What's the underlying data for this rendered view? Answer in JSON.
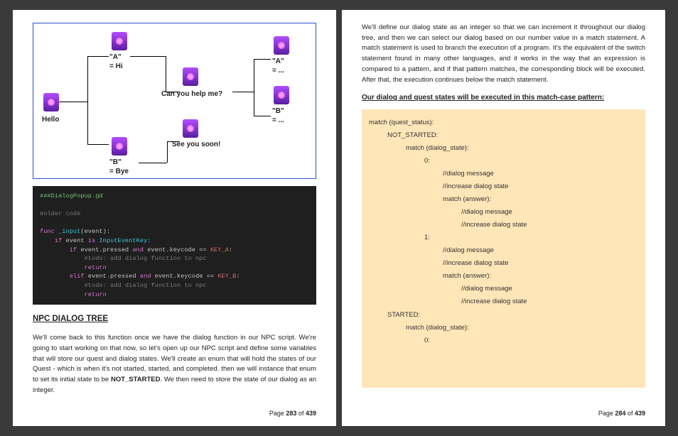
{
  "page_left": {
    "diagram": {
      "hello": "Hello",
      "a_hi_key": "\"A\"",
      "a_hi_val": "= Hi",
      "b_bye_key": "\"B\"",
      "b_bye_val": "= Bye",
      "can_help": "Can you help me?",
      "see_you": "See you soon!",
      "topA_key": "\"A\"",
      "topA_val": "= ...",
      "topB_key": "\"B\"",
      "topB_val": "= ..."
    },
    "code": {
      "l1": "###DialogPopup.gd",
      "l2": "#older code",
      "l3a": "func",
      "l3b": " _input",
      "l3c": "(event):",
      "l4a": "    if",
      "l4b": " event ",
      "l4c": "is",
      "l4d": " InputEventKey:",
      "l5a": "        if",
      "l5b": " event.pressed ",
      "l5c": "and",
      "l5d": " event.keycode == ",
      "l5e": "KEY_A",
      "l5f": ":",
      "l6": "            #todo: add dialog function to npc",
      "l7": "            return",
      "l8a": "        elif",
      "l8b": " event.pressed ",
      "l8c": "and",
      "l8d": " event.keycode == ",
      "l8e": "KEY_B",
      "l8f": ":",
      "l9": "            #todo: add dialog function to npc",
      "l10": "            return"
    },
    "heading": "NPC DIALOG TREE",
    "para_pre": "We'll come back to this function once we have the dialog function in our NPC script. We're going to start working on that now, so let's open up our NPC script and define some variables that will store our quest and dialog states. We'll create an enum that will hold the states of our Quest - which is when it's not started, started, and completed. then we will instance that enum to set its initial state to be ",
    "para_bold": "NOT_STARTED",
    "para_post": ". We then need to store the state of our dialog as an integer.",
    "pagelabel_pre": "Page ",
    "pagelabel_num": "283",
    "pagelabel_mid": " of ",
    "pagelabel_total": "439"
  },
  "page_right": {
    "para": "We'll define our dialog state as an integer so that we can increment it throughout our dialog tree, and then we can select our dialog based on our number value in a match statement. A match statement is used to branch the execution of a program. It's the equivalent of the switch statement found in many other languages, and it works in the way that an expression is compared to a pattern, and if that pattern matches, the corresponding block will be executed. After that, the execution continues below the match statement.",
    "subheading": "Our dialog and quest states will be executed in this match-case pattern:",
    "match": {
      "l1": "match (quest_status):",
      "l2": "NOT_STARTED:",
      "l3": "match (dialog_state):",
      "l4": "0:",
      "l5": "//dialog message",
      "l6": "//increase dialog state",
      "l7": "match (answer):",
      "l8": "//dialog message",
      "l9": "//increase dialog state",
      "l10": "1:",
      "l11": "//dialog message",
      "l12": "//increase dialog state",
      "l13": "match (answer):",
      "l14": "//dialog message",
      "l15": "//increase dialog state",
      "l16": "STARTED:",
      "l17": "match (dialog_state):",
      "l18": "0:"
    },
    "pagelabel_pre": "Page ",
    "pagelabel_num": "284",
    "pagelabel_mid": " of ",
    "pagelabel_total": "439"
  }
}
